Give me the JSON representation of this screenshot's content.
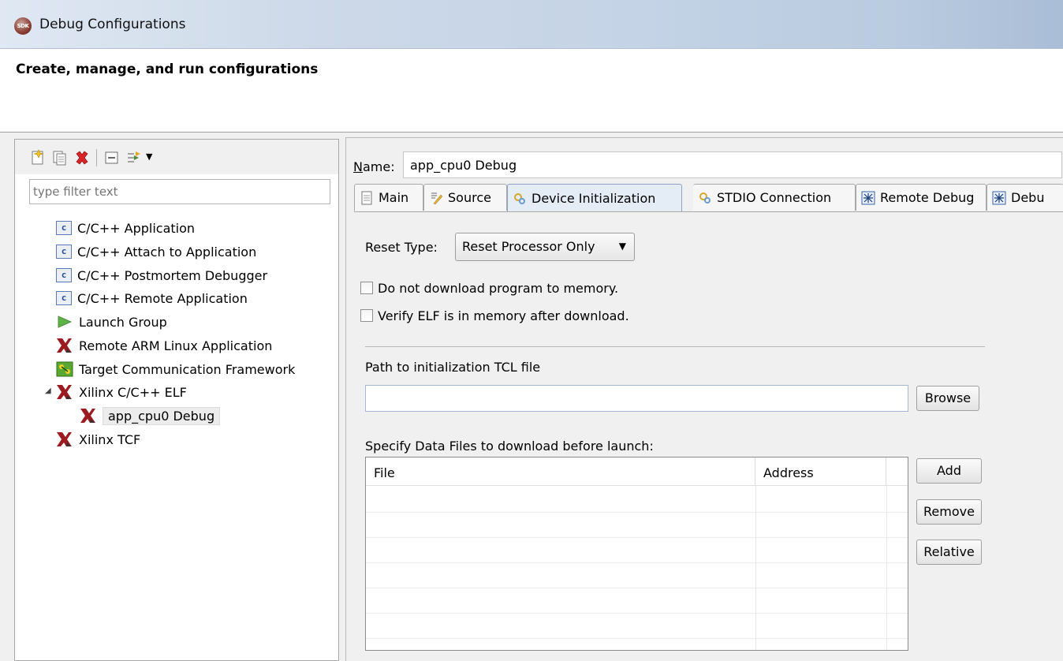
{
  "window": {
    "title": "Debug Configurations",
    "icon": "sdk-icon",
    "icon_text": "SDK"
  },
  "header": {
    "title": "Create, manage, and run configurations"
  },
  "toolbar": {
    "buttons": [
      "new-config-icon",
      "duplicate-icon",
      "delete-icon",
      "collapse-all-icon",
      "filter-icon",
      "dropdown-icon"
    ]
  },
  "filter": {
    "placeholder": "type filter text"
  },
  "tree": {
    "items": [
      {
        "label": "C/C++ Application",
        "icon": "c-icon"
      },
      {
        "label": "C/C++ Attach to Application",
        "icon": "c-icon"
      },
      {
        "label": "C/C++ Postmortem Debugger",
        "icon": "c-icon"
      },
      {
        "label": "C/C++ Remote Application",
        "icon": "c-icon"
      },
      {
        "label": "Launch Group",
        "icon": "play-icon"
      },
      {
        "label": "Remote ARM Linux Application",
        "icon": "xilinx-icon"
      },
      {
        "label": "Target Communication Framework",
        "icon": "tcf-icon"
      },
      {
        "label": "Xilinx C/C++ ELF",
        "icon": "xilinx-icon",
        "expanded": true
      },
      {
        "label": "app_cpu0 Debug",
        "icon": "xilinx-icon",
        "selected": true
      },
      {
        "label": "Xilinx TCF",
        "icon": "xilinx-icon"
      }
    ]
  },
  "config": {
    "name_label_first": "N",
    "name_label_rest": "ame:",
    "name_value": "app_cpu0 Debug"
  },
  "tabs": [
    {
      "label": "Main",
      "icon": "document-icon"
    },
    {
      "label": "Source",
      "icon": "source-icon"
    },
    {
      "label": "Device Initialization",
      "icon": "gears-icon",
      "active": true
    },
    {
      "label": "STDIO Connection",
      "icon": "gears-icon"
    },
    {
      "label": "Remote Debug",
      "icon": "debug-icon"
    },
    {
      "label": "Debu",
      "icon": "debug-icon"
    }
  ],
  "panel": {
    "reset_type_label": "Reset Type:",
    "reset_type_value": "Reset Processor Only",
    "checkbox_no_download": "Do not download program to memory.",
    "checkbox_verify_elf": "Verify ELF is in memory after download.",
    "path_label": "Path to initialization TCL file",
    "path_value": "",
    "browse_label": "Browse",
    "data_files_label": "Specify Data Files to download before launch:",
    "table_columns": [
      "File",
      "Address"
    ],
    "add_label": "Add",
    "remove_label": "Remove",
    "relative_label": "Relative"
  },
  "colors": {
    "title_bar": "#c4d3e6",
    "active_tab": "#e4ecf6",
    "window_bg": "#f0f0f0"
  }
}
